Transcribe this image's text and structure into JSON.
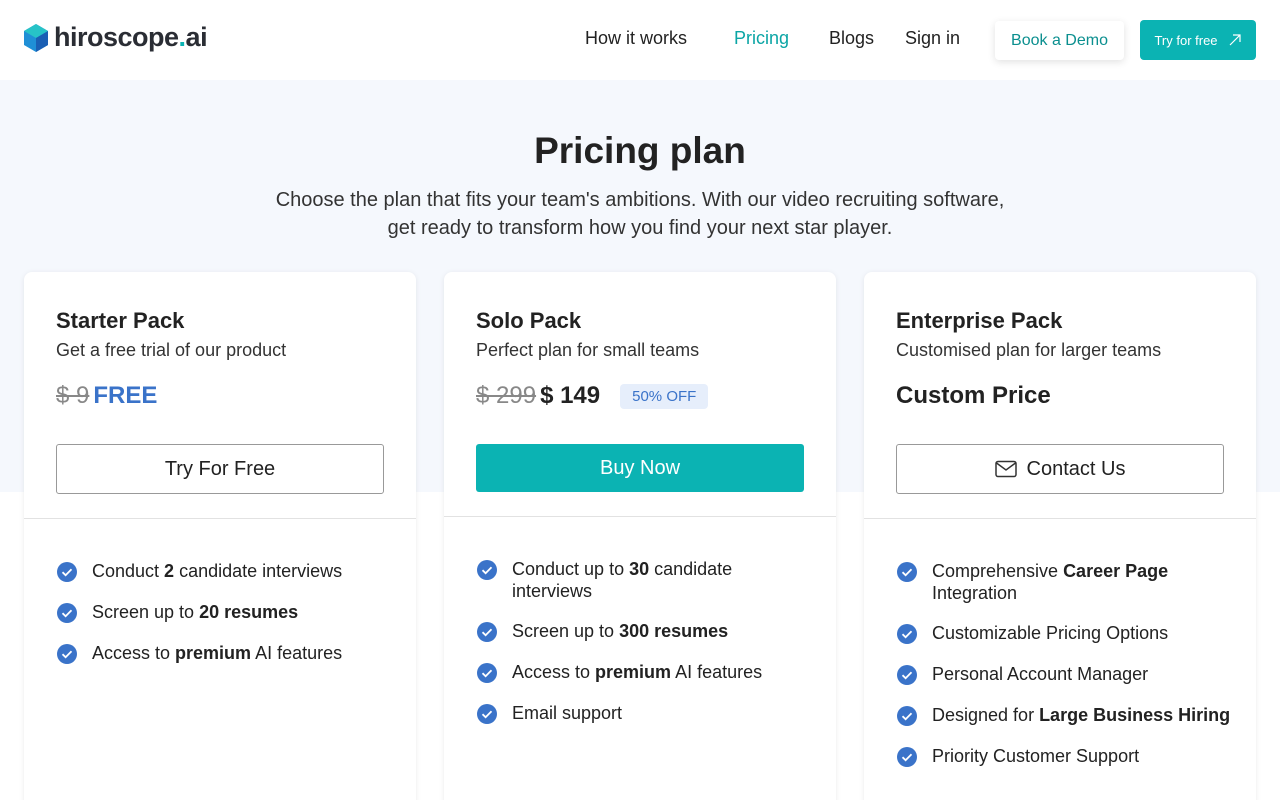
{
  "header": {
    "logo": {
      "main": "hiroscope",
      "dot": ".",
      "suffix": "ai"
    },
    "nav": [
      "How it works",
      "Pricing",
      "Blogs",
      "Sign in"
    ],
    "active_nav": "Pricing",
    "book_demo": "Book a Demo",
    "try_free": "Try for free"
  },
  "hero": {
    "title": "Pricing plan",
    "subtitle_line1": "Choose the plan that fits your team's ambitions. With our video recruiting software,",
    "subtitle_line2": "get ready to transform how you find your next star player."
  },
  "plans": [
    {
      "title": "Starter Pack",
      "subtitle": "Get a free trial of our product",
      "price_old": "$ 9",
      "price_new": "FREE",
      "button": "Try For Free",
      "features": [
        {
          "pre": "Conduct ",
          "bold": "2",
          "post": " candidate interviews"
        },
        {
          "pre": "Screen up to ",
          "bold": "20 resumes",
          "post": ""
        },
        {
          "pre": "Access to ",
          "bold": "premium",
          "post": " AI features"
        }
      ]
    },
    {
      "title": "Solo Pack",
      "subtitle": "Perfect plan for small teams",
      "price_old": "$ 299",
      "price_new": "$ 149",
      "badge": "50% OFF",
      "button": "Buy Now",
      "features": [
        {
          "pre": "Conduct up to ",
          "bold": "30",
          "post": " candidate interviews"
        },
        {
          "pre": "Screen up to ",
          "bold": "300 resumes",
          "post": ""
        },
        {
          "pre": "Access to ",
          "bold": "premium",
          "post": " AI features"
        },
        {
          "pre": "Email support",
          "bold": "",
          "post": ""
        }
      ]
    },
    {
      "title": "Enterprise Pack",
      "subtitle": "Customised plan for larger teams",
      "price_custom": "Custom Price",
      "button": "Contact Us",
      "features": [
        {
          "pre": "Comprehensive ",
          "bold": "Career Page",
          "post": " Integration"
        },
        {
          "pre": "Customizable Pricing Options",
          "bold": "",
          "post": ""
        },
        {
          "pre": "Personal Account Manager",
          "bold": "",
          "post": ""
        },
        {
          "pre": "Designed for ",
          "bold": "Large Business Hiring",
          "post": ""
        },
        {
          "pre": "Priority Customer Support",
          "bold": "",
          "post": ""
        }
      ]
    }
  ],
  "colors": {
    "teal": "#0bb3b3",
    "blue": "#3a73c9",
    "hero_bg": "#f5f8fd"
  }
}
